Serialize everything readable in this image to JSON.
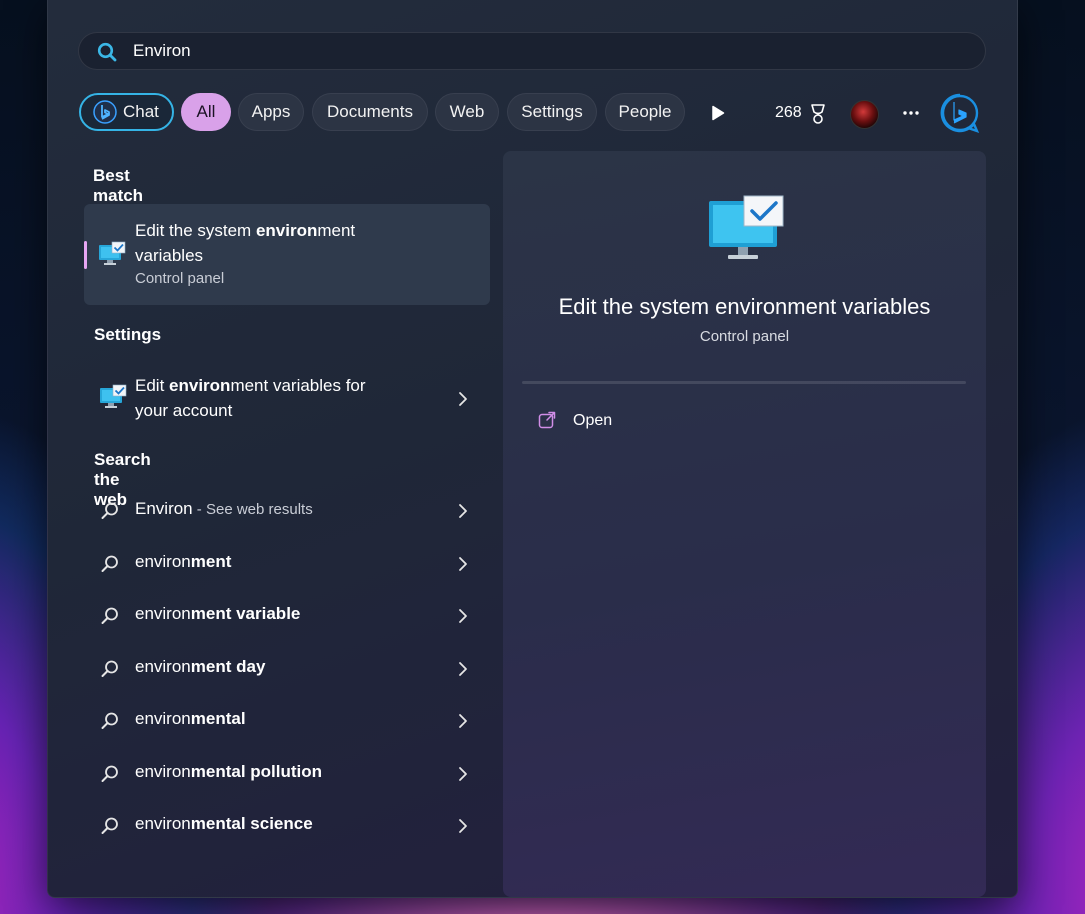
{
  "search": {
    "query": "Environ"
  },
  "filters": {
    "chat": "Chat",
    "tabs": [
      "All",
      "Apps",
      "Documents",
      "Web",
      "Settings",
      "People"
    ],
    "active_tab": "All",
    "points": "268"
  },
  "best_match": {
    "heading": "Best match",
    "title_pre": "Edit the system ",
    "title_bold": "environ",
    "title_post": "ment",
    "title_line2": "variables",
    "subtitle": "Control panel"
  },
  "settings_section": {
    "heading": "Settings",
    "item": {
      "pre": "Edit ",
      "bold": "environ",
      "post": "ment variables for",
      "line2": "your account"
    }
  },
  "web_section": {
    "heading": "Search the web",
    "first": {
      "text": "Environ",
      "hint": " - See web results"
    },
    "suggestions": [
      {
        "plain": "environ",
        "bold": "ment"
      },
      {
        "plain": "environ",
        "bold": "ment variable"
      },
      {
        "plain": "environ",
        "bold": "ment day"
      },
      {
        "plain": "environ",
        "bold": "mental"
      },
      {
        "plain": "environ",
        "bold": "mental pollution"
      },
      {
        "plain": "environ",
        "bold": "mental science"
      }
    ]
  },
  "preview": {
    "title": "Edit the system environment variables",
    "subtitle": "Control panel",
    "action": "Open"
  },
  "colors": {
    "accent_pill": "#d9a1e9",
    "chat_border": "#35b4e6",
    "selection_bar": "#e7a6f3",
    "bing_blue": "#1a8fe0"
  },
  "icons": [
    "search-icon",
    "bing-icon",
    "play-icon",
    "trophy-icon",
    "avatar",
    "more-icon",
    "control-panel-icon",
    "open-external-icon",
    "chevron-right-icon"
  ]
}
